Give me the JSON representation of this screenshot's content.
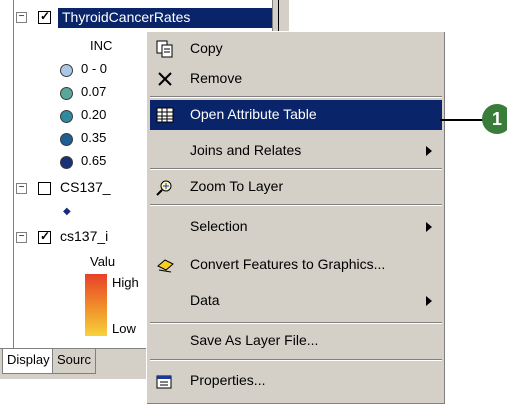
{
  "toc": {
    "layers": [
      {
        "name": "ThyroidCancerRates",
        "checked": true,
        "field_label": "INC",
        "classes": [
          "0 - 0",
          "0.07",
          "0.20",
          "0.35",
          "0.65"
        ],
        "class_colors": [
          "#a9c8e8",
          "#5aa69a",
          "#2e8aa0",
          "#1d5f92",
          "#16337a"
        ]
      },
      {
        "name": "CS137_",
        "checked": false
      },
      {
        "name": "cs137_i",
        "checked": true,
        "value_label": "Valu",
        "high_label": "High",
        "low_label": "Low"
      }
    ],
    "tabs": [
      "Display",
      "Sourc"
    ]
  },
  "context_menu": {
    "items": [
      {
        "label": "Copy",
        "icon": "copy-icon"
      },
      {
        "label": "Remove",
        "icon": "remove-x-icon"
      },
      {
        "label": "Open Attribute Table",
        "icon": "table-icon",
        "highlighted": true
      },
      {
        "label": "Joins and Relates",
        "submenu": true
      },
      {
        "label": "Zoom To Layer",
        "icon": "zoom-to-layer-icon"
      },
      {
        "label": "Selection",
        "submenu": true
      },
      {
        "label": "Convert Features to Graphics...",
        "icon": "convert-features-icon"
      },
      {
        "label": "Data",
        "submenu": true
      },
      {
        "label": "Save As Layer File..."
      },
      {
        "label": "Properties...",
        "icon": "properties-icon"
      }
    ]
  },
  "callout": {
    "number": "1"
  },
  "colors": {
    "highlight": "#0a246a",
    "menu_bg": "#d4d0c8",
    "callout": "#3a7d3a"
  }
}
